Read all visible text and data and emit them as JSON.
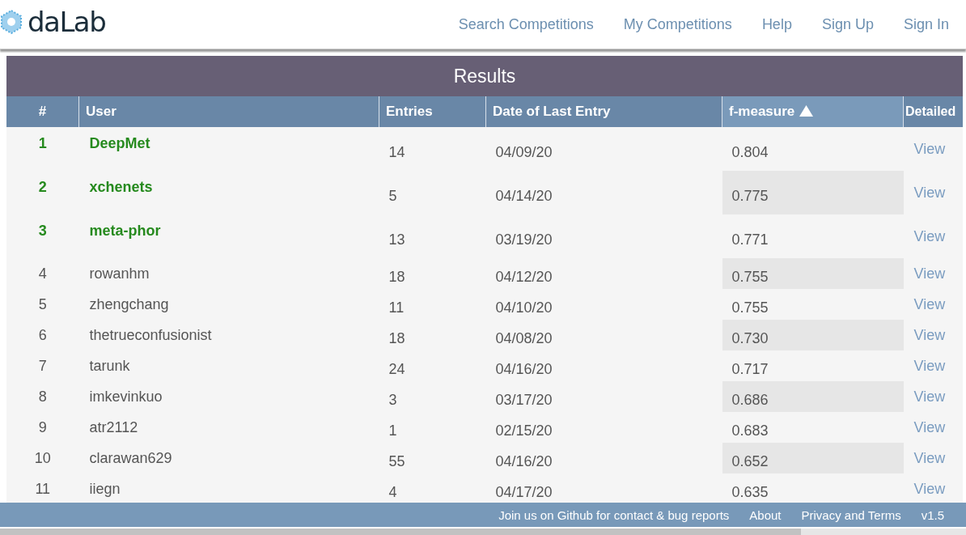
{
  "header": {
    "logo_text": "daLab",
    "nav": [
      "Search Competitions",
      "My Competitions",
      "Help",
      "Sign Up",
      "Sign In"
    ]
  },
  "results": {
    "title": "Results",
    "columns": [
      {
        "label": "#",
        "sorted": false
      },
      {
        "label": "User",
        "sorted": false
      },
      {
        "label": "Entries",
        "sorted": false
      },
      {
        "label": "Date of Last Entry",
        "sorted": false
      },
      {
        "label": "f-measure",
        "sorted": true
      },
      {
        "label": "Detailed",
        "sorted": false
      }
    ],
    "rows": [
      {
        "rank": "1",
        "user": "DeepMet",
        "entries": "14",
        "date": "04/09/20",
        "score": "0.804",
        "link": "View",
        "top": true
      },
      {
        "rank": "2",
        "user": "xchenets",
        "entries": "5",
        "date": "04/14/20",
        "score": "0.775",
        "link": "View",
        "top": true
      },
      {
        "rank": "3",
        "user": "meta-phor",
        "entries": "13",
        "date": "03/19/20",
        "score": "0.771",
        "link": "View",
        "top": true
      },
      {
        "rank": "4",
        "user": "rowanhm",
        "entries": "18",
        "date": "04/12/20",
        "score": "0.755",
        "link": "View",
        "top": false
      },
      {
        "rank": "5",
        "user": "zhengchang",
        "entries": "11",
        "date": "04/10/20",
        "score": "0.755",
        "link": "View",
        "top": false
      },
      {
        "rank": "6",
        "user": "thetrueconfusionist",
        "entries": "18",
        "date": "04/08/20",
        "score": "0.730",
        "link": "View",
        "top": false
      },
      {
        "rank": "7",
        "user": "tarunk",
        "entries": "24",
        "date": "04/16/20",
        "score": "0.717",
        "link": "View",
        "top": false
      },
      {
        "rank": "8",
        "user": "imkevinkuo",
        "entries": "3",
        "date": "03/17/20",
        "score": "0.686",
        "link": "View",
        "top": false
      },
      {
        "rank": "9",
        "user": "atr2112",
        "entries": "1",
        "date": "02/15/20",
        "score": "0.683",
        "link": "View",
        "top": false
      },
      {
        "rank": "10",
        "user": "clarawan629",
        "entries": "55",
        "date": "04/16/20",
        "score": "0.652",
        "link": "View",
        "top": false
      },
      {
        "rank": "11",
        "user": "iiegn",
        "entries": "4",
        "date": "04/17/20",
        "score": "0.635",
        "link": "View",
        "top": false
      }
    ]
  },
  "footer": {
    "links": [
      "Join us on Github for contact & bug reports",
      "About",
      "Privacy and Terms"
    ],
    "version": "v1.5"
  }
}
